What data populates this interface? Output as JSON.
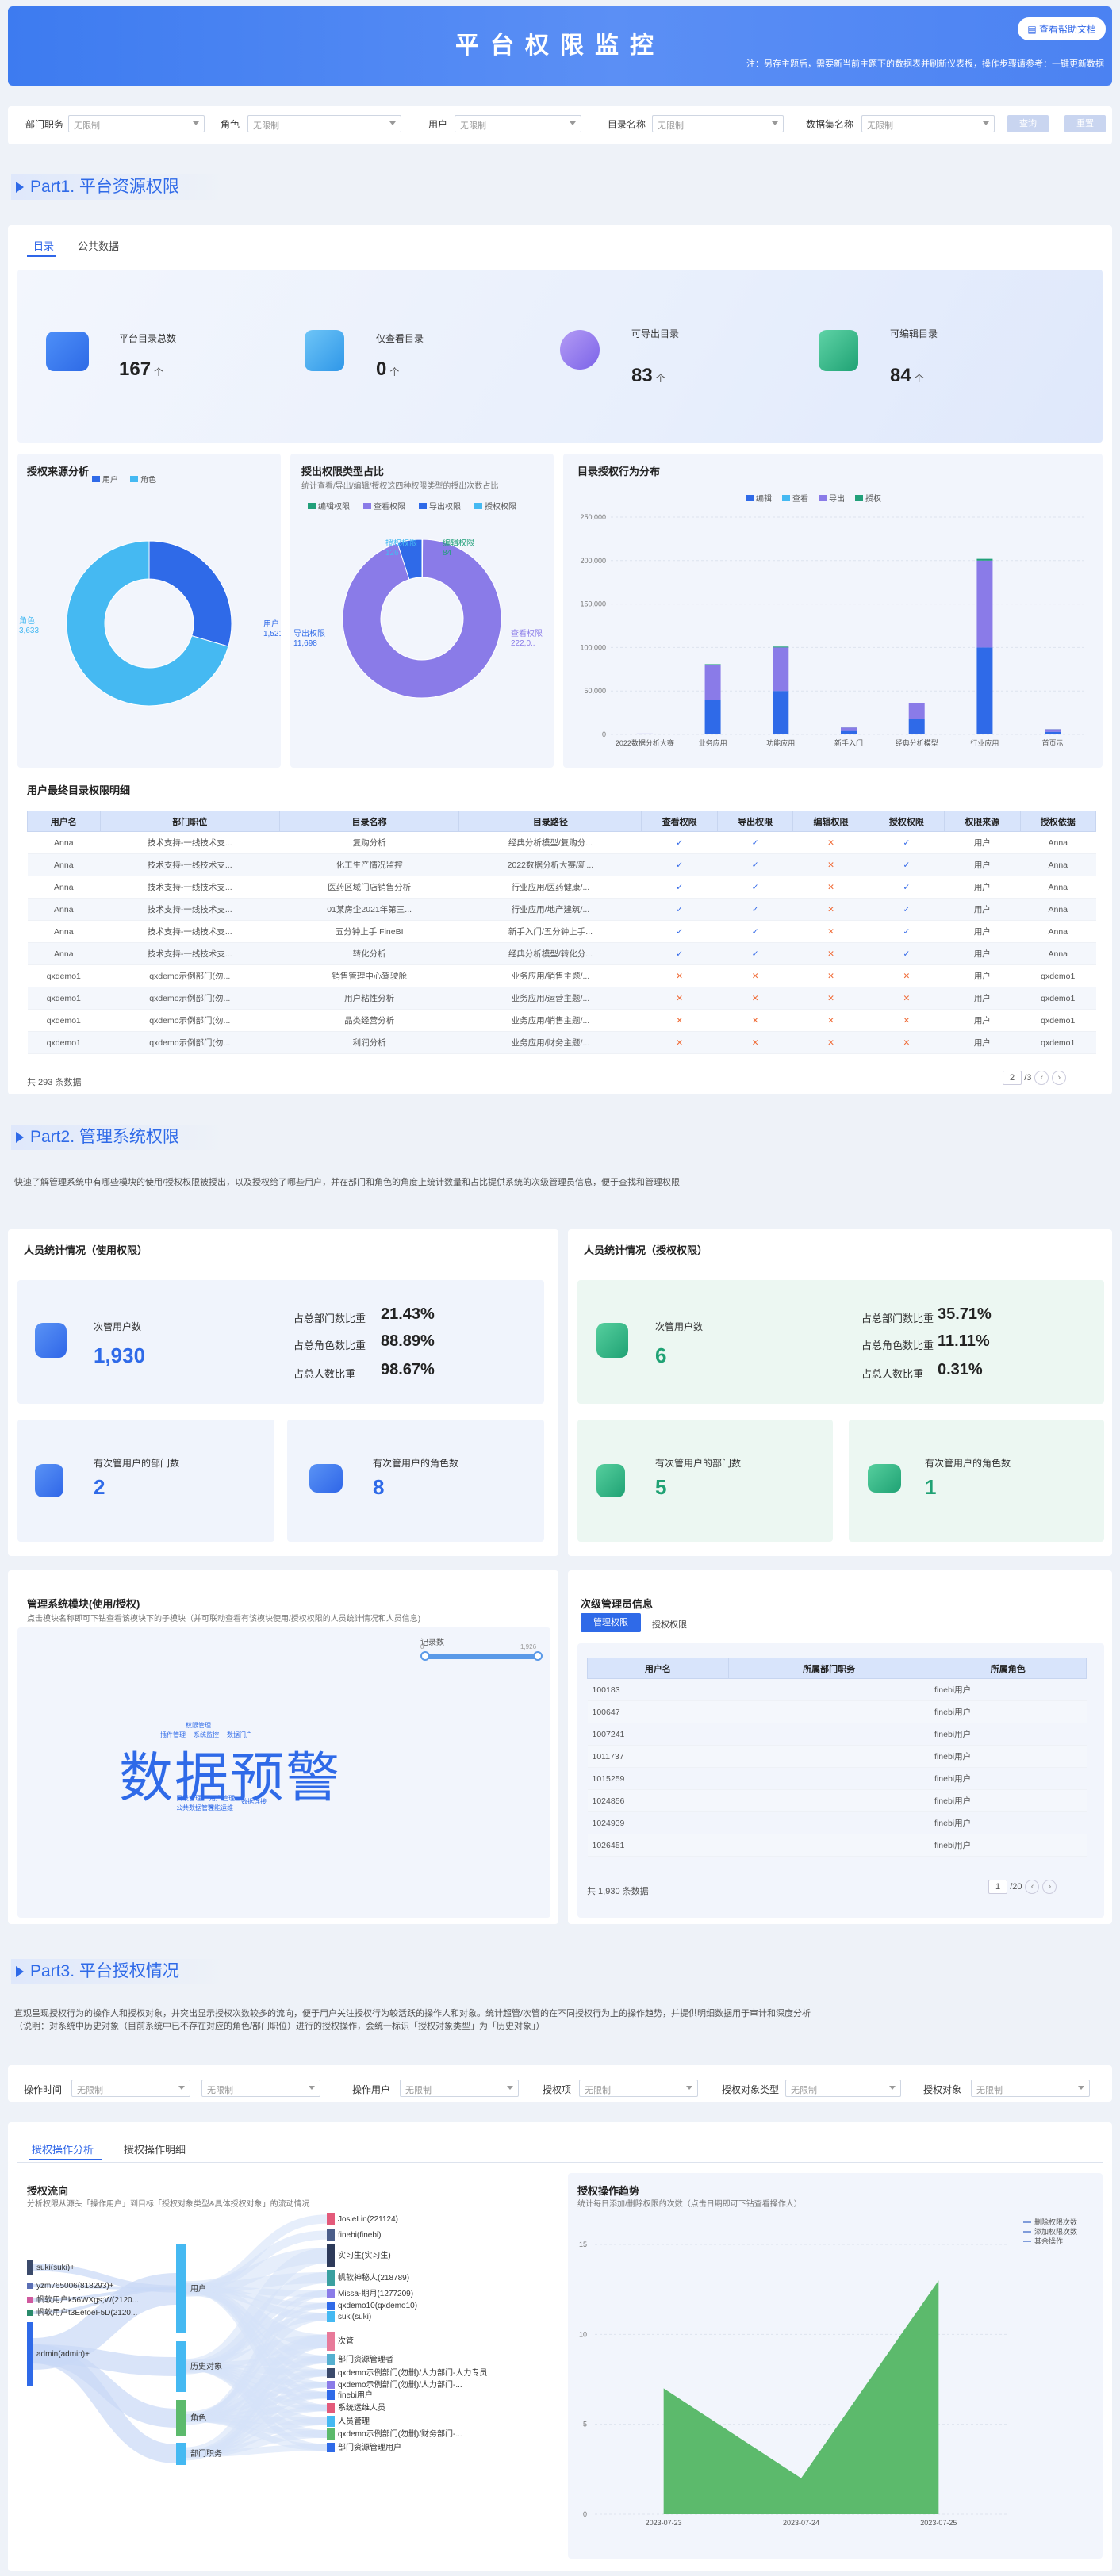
{
  "header": {
    "title": "平台权限监控",
    "help": "查看帮助文档",
    "note": "注：另存主题后，需要新当前主题下的数据表并刷新仪表板，操作步骤请参考：一键更新数据"
  },
  "filters": {
    "dept_label": "部门职务",
    "role_label": "角色",
    "user_label": "用户",
    "dir_label": "目录名称",
    "dataset_label": "数据集名称",
    "placeholder": "无限制",
    "query": "查询",
    "reset": "重置"
  },
  "part1": {
    "title": "Part1. 平台资源权限",
    "tabs": [
      "目录",
      "公共数据"
    ],
    "stats": [
      {
        "label": "平台目录总数",
        "value": "167",
        "unit": "个"
      },
      {
        "label": "仅查看目录",
        "value": "0",
        "unit": "个"
      },
      {
        "label": "可导出目录",
        "value": "83",
        "unit": "个"
      },
      {
        "label": "可编辑目录",
        "value": "84",
        "unit": "个"
      }
    ],
    "source_title": "授权来源分析",
    "type_title": "授出权限类型占比",
    "type_sub": "统计查看/导出/编辑/授权这四种权限类型的授出次数占比",
    "dist_title": "目录授权行为分布",
    "detail_title": "用户最终目录权限明细",
    "table_headers": [
      "用户名",
      "部门职位",
      "目录名称",
      "目录路径",
      "查看权限",
      "导出权限",
      "编辑权限",
      "授权权限",
      "权限来源",
      "授权依据"
    ],
    "rows": [
      [
        "Anna",
        "技术支持-一线技术支...",
        "复购分析",
        "经典分析模型/复购分...",
        "y",
        "y",
        "x",
        "y",
        "用户",
        "Anna"
      ],
      [
        "Anna",
        "技术支持-一线技术支...",
        "化工生产情况监控",
        "2022数据分析大赛/新...",
        "y",
        "y",
        "x",
        "y",
        "用户",
        "Anna"
      ],
      [
        "Anna",
        "技术支持-一线技术支...",
        "医药区域门店销售分析",
        "行业应用/医药健康/...",
        "y",
        "y",
        "x",
        "y",
        "用户",
        "Anna"
      ],
      [
        "Anna",
        "技术支持-一线技术支...",
        "01某房企2021年第三...",
        "行业应用/地产建筑/...",
        "y",
        "y",
        "x",
        "y",
        "用户",
        "Anna"
      ],
      [
        "Anna",
        "技术支持-一线技术支...",
        "五分钟上手 FineBI",
        "新手入门/五分钟上手...",
        "y",
        "y",
        "x",
        "y",
        "用户",
        "Anna"
      ],
      [
        "Anna",
        "技术支持-一线技术支...",
        "转化分析",
        "经典分析模型/转化分...",
        "y",
        "y",
        "x",
        "y",
        "用户",
        "Anna"
      ],
      [
        "qxdemo1",
        "qxdemo示例部门(勿...",
        "销售管理中心驾驶舱",
        "业务应用/销售主题/...",
        "x",
        "x",
        "x",
        "x",
        "用户",
        "qxdemo1"
      ],
      [
        "qxdemo1",
        "qxdemo示例部门(勿...",
        "用户粘性分析",
        "业务应用/运营主题/...",
        "x",
        "x",
        "x",
        "x",
        "用户",
        "qxdemo1"
      ],
      [
        "qxdemo1",
        "qxdemo示例部门(勿...",
        "品类经营分析",
        "业务应用/销售主题/...",
        "x",
        "x",
        "x",
        "x",
        "用户",
        "qxdemo1"
      ],
      [
        "qxdemo1",
        "qxdemo示例部门(勿...",
        "利润分析",
        "业务应用/财务主题/...",
        "x",
        "x",
        "x",
        "x",
        "用户",
        "qxdemo1"
      ]
    ],
    "total_text": "共 293 条数据",
    "page": "2",
    "page_total": "/3"
  },
  "part2": {
    "title": "Part2. 管理系统权限",
    "desc": "快速了解管理系统中有哪些模块的使用/授权权限被授出，以及授权给了哪些用户，并在部门和角色的角度上统计数量和占比提供系统的次级管理员信息，便于查找和管理权限",
    "use_title": "人员统计情况（使用权限）",
    "grant_title": "人员统计情况（授权权限）",
    "use": {
      "main_label": "次管用户数",
      "main_value": "1,930",
      "r1_l": "占总部门数比重",
      "r1_v": "21.43%",
      "r2_l": "占总角色数比重",
      "r2_v": "88.89%",
      "r3_l": "占总人数比重",
      "r3_v": "98.67%",
      "dept_l": "有次管用户的部门数",
      "dept_v": "2",
      "role_l": "有次管用户的角色数",
      "role_v": "8"
    },
    "grant": {
      "main_label": "次管用户数",
      "main_value": "6",
      "r1_l": "占总部门数比重",
      "r1_v": "35.71%",
      "r2_l": "占总角色数比重",
      "r2_v": "11.11%",
      "r3_l": "占总人数比重",
      "r3_v": "0.31%",
      "dept_l": "有次管用户的部门数",
      "dept_v": "5",
      "role_l": "有次管用户的角色数",
      "role_v": "1"
    },
    "module_title": "管理系统模块(使用/授权)",
    "module_sub": "点击模块名称即可下钻查看该模块下的子模块（并可联动查看有该模块使用/授权权限的人员统计情况和人员信息)",
    "slider_label": "记录数",
    "slider_min": "0",
    "slider_max": "1,926",
    "wordcloud_main": "数据预警",
    "wordcloud_small": [
      "权限管理",
      "插件管理",
      "系统监控",
      "数据门户",
      "目录管理",
      "用户管理",
      "公共数据管理",
      "智能运维",
      "数据连接"
    ],
    "admin_title": "次级管理员信息",
    "admin_tabs": [
      "管理权限",
      "授权权限"
    ],
    "admin_headers": [
      "用户名",
      "所属部门职务",
      "所属角色"
    ],
    "admin_rows": [
      [
        "100183",
        "",
        "finebi用户"
      ],
      [
        "100647",
        "",
        "finebi用户"
      ],
      [
        "1007241",
        "",
        "finebi用户"
      ],
      [
        "1011737",
        "",
        "finebi用户"
      ],
      [
        "1015259",
        "",
        "finebi用户"
      ],
      [
        "1024856",
        "",
        "finebi用户"
      ],
      [
        "1024939",
        "",
        "finebi用户"
      ],
      [
        "1026451",
        "",
        "finebi用户"
      ]
    ],
    "admin_total": "共 1,930 条数据",
    "admin_page": "1",
    "admin_page_total": "/20"
  },
  "part3": {
    "title": "Part3. 平台授权情况",
    "desc1": "直观呈现授权行为的操作人和授权对象，并突出显示授权次数较多的流向，便于用户关注授权行为较活跃的操作人和对象。统计超管/次管的在不同授权行为上的操作趋势，并提供明细数据用于审计和深度分析",
    "desc2": "（说明：对系统中历史对象（目前系统中已不存在对应的角色/部门职位）进行的授权操作，会统一标识「授权对象类型」为「历史对象」）",
    "f_time": "操作时间",
    "f_op_user": "操作用户",
    "f_item": "授权项",
    "f_obj_type": "授权对象类型",
    "f_obj": "授权对象",
    "tabs": [
      "授权操作分析",
      "授权操作明细"
    ],
    "flow_title": "授权流向",
    "flow_sub": "分析权限从源头「操作用户」到目标「授权对象类型&具体授权对象」的流动情况",
    "sources": [
      "suki(suki)+",
      "yzm765006(818293)+",
      "帆软用户k56WXgs;W(2120...",
      "帆软用户t3EetoeF5D(2120...",
      "admin(admin)+"
    ],
    "middles": [
      "用户",
      "历史对象",
      "角色",
      "部门职务"
    ],
    "targets": [
      "JosieLin(221124)",
      "finebi(finebi)",
      "实习生(实习生)",
      "帆软神秘人(218789)",
      "Missa-期月(1277209)",
      "qxdemo10(qxdemo10)",
      "suki(suki)",
      "次管",
      "部门资源管理者",
      "qxdemo示例部门(勿删)/人力部门-人力专员",
      "qxdemo示例部门(勿删)/人力部门-...",
      "finebi用户",
      "系统运维人员",
      "人员管理",
      "qxdemo示例部门(勿删)/财务部门-...",
      "部门资源管理用户"
    ],
    "trend_title": "授权操作趋势",
    "trend_sub": "统计每日添加/删除权限的次数（点击日期即可下钻查看操作人）"
  },
  "chart_data": [
    {
      "type": "pie",
      "title": "授权来源分析",
      "labels": [
        "用户",
        "角色"
      ],
      "values": [
        1521,
        3633
      ],
      "colors": [
        "#2f6ae8",
        "#45b9f2"
      ]
    },
    {
      "type": "pie",
      "title": "授出权限类型占比",
      "labels": [
        "编辑权限",
        "查看权限",
        "导出权限",
        "授权权限"
      ],
      "values": [
        84,
        222000,
        11698,
        126
      ],
      "colors": [
        "#22a07a",
        "#8a7be8",
        "#2f6ae8",
        "#45b9f2"
      ],
      "display_values": [
        "84",
        "222,0..",
        "11,698",
        "126"
      ]
    },
    {
      "type": "bar",
      "title": "目录授权行为分布",
      "stacked": true,
      "categories": [
        "2022数据分析大赛",
        "业务应用",
        "功能应用",
        "新手入门",
        "经典分析模型",
        "行业应用",
        "首页示"
      ],
      "series": [
        {
          "name": "编辑",
          "values": [
            500,
            40000,
            50000,
            4000,
            18000,
            100000,
            3000
          ],
          "color": "#2f6ae8"
        },
        {
          "name": "查看",
          "values": [
            0,
            0,
            0,
            0,
            0,
            0,
            0
          ],
          "color": "#45b9f2"
        },
        {
          "name": "导出",
          "values": [
            500,
            40000,
            50000,
            4000,
            18000,
            100000,
            3000
          ],
          "color": "#8a7be8"
        },
        {
          "name": "授权",
          "values": [
            0,
            800,
            1000,
            100,
            400,
            2000,
            100
          ],
          "color": "#22a07a"
        }
      ],
      "ylim": [
        0,
        250000
      ],
      "yticks": [
        "0",
        "50,000",
        "100,000",
        "150,000",
        "200,000",
        "250,000"
      ]
    },
    {
      "type": "area",
      "title": "授权操作趋势",
      "x": [
        "2023-07-23",
        "2023-07-24",
        "2023-07-25"
      ],
      "series": [
        {
          "name": "删除权限次数",
          "values": [
            7,
            2,
            13
          ]
        }
      ],
      "legend": [
        "删除权限次数",
        "添加权限次数",
        "其余操作"
      ],
      "ylim": [
        0,
        15
      ],
      "yticks": [
        "0",
        "5",
        "10",
        "15"
      ],
      "color": "#5cba6c"
    }
  ]
}
